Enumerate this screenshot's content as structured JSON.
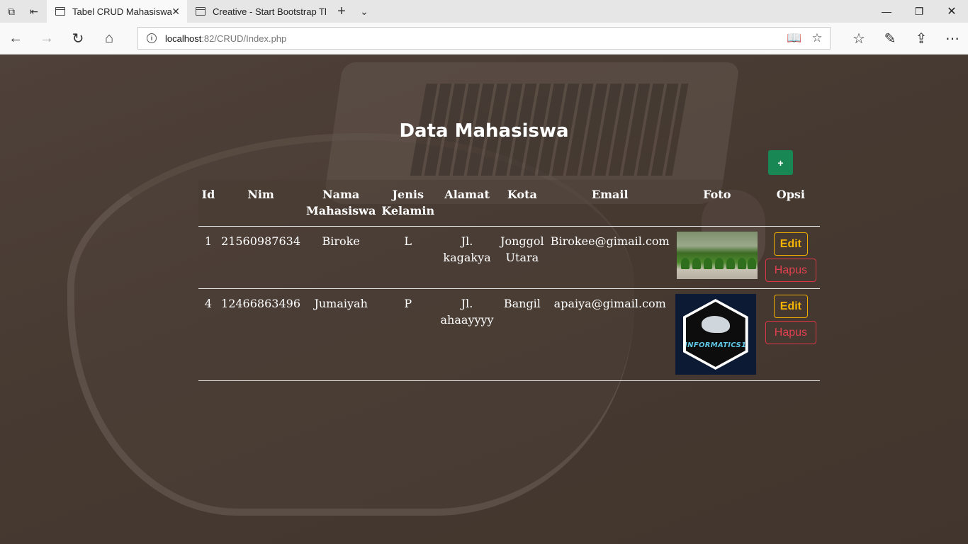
{
  "browser": {
    "tabs": [
      {
        "title": "Tabel CRUD Mahasiswa",
        "active": true
      },
      {
        "title": "Creative - Start Bootstrap Tl",
        "active": false
      }
    ],
    "url_host": "localhost",
    "url_rest": ":82/CRUD/Index.php"
  },
  "page": {
    "title": "Data Mahasiswa",
    "add_label": "+",
    "columns": [
      "Id",
      "Nim",
      "Nama Mahasiswa",
      "Jenis Kelamin",
      "Alamat",
      "Kota",
      "Email",
      "Foto",
      "Opsi"
    ],
    "rows": [
      {
        "id": "1",
        "nim": "21560987634",
        "nama": "Biroke",
        "jk": "L",
        "alamat": "Jl. kagakya",
        "kota": "Jonggol Utara",
        "email": "Birokee@gimail.com",
        "foto": "plant-nursery-photo",
        "edit": "Edit",
        "hapus": "Hapus"
      },
      {
        "id": "4",
        "nim": "12466863496",
        "nama": "Jumaiyah",
        "jk": "P",
        "alamat": "Jl. ahaayyyy",
        "kota": "Bangil",
        "email": "apaiya@gimail.com",
        "foto": "informatics-logo",
        "logo_text": "INFORMATICS1",
        "edit": "Edit",
        "hapus": "Hapus"
      }
    ]
  },
  "colors": {
    "add_button": "#198754",
    "edit": "#f5b400",
    "hapus": "#e2404f"
  }
}
